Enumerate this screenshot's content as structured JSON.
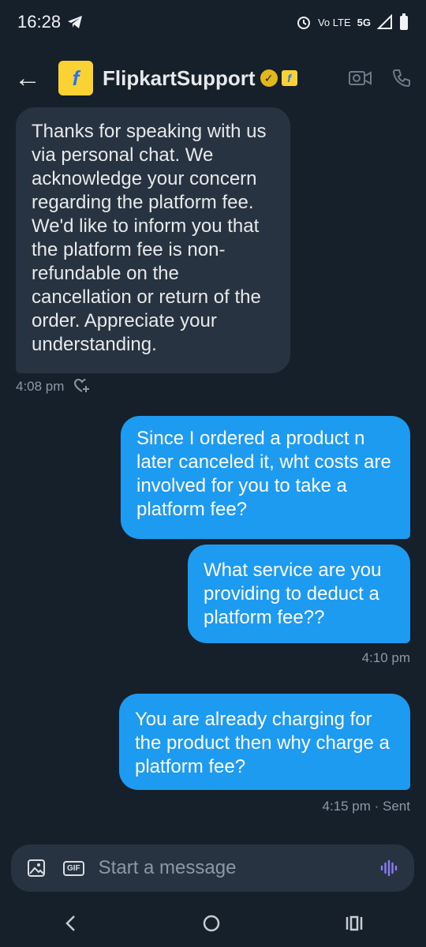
{
  "status_bar": {
    "time": "16:28",
    "network": "5G",
    "volte": "Vo LTE"
  },
  "header": {
    "title": "FlipkartSupport",
    "avatar_letter": "f"
  },
  "messages": [
    {
      "direction": "incoming",
      "text": "Thanks for speaking with us via personal chat. We acknowledge your concern regarding the platform fee. We'd like to inform you that the platform fee is non-refundable on the cancellation or return of the order. Appreciate your understanding.",
      "time": "4:08 pm"
    },
    {
      "direction": "outgoing",
      "text": "Since I ordered a product n later canceled it, wht costs are involved for you to take a platform fee?"
    },
    {
      "direction": "outgoing",
      "text": "What service are you providing to deduct a platform fee??",
      "time": "4:10 pm"
    },
    {
      "direction": "outgoing",
      "text": "You are already charging for the product then why charge a platform fee?",
      "time": "4:15 pm · Sent"
    }
  ],
  "composer": {
    "placeholder": "Start a message",
    "gif_label": "GIF"
  },
  "colors": {
    "background": "#15202b",
    "incoming_bubble": "#273340",
    "outgoing_bubble": "#1d9bf0",
    "verified_badge": "#e2b719",
    "voice_accent": "#8b7cf6"
  }
}
